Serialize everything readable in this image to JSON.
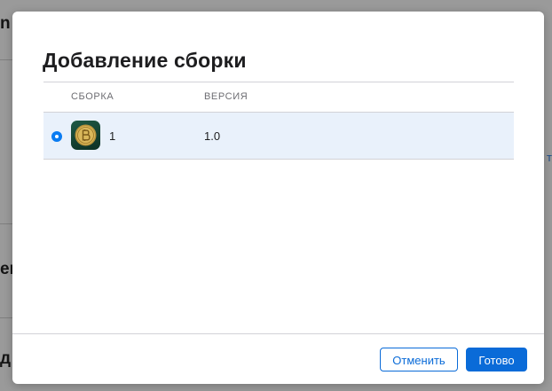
{
  "background": {
    "fragments": [
      "n",
      "er",
      "д"
    ],
    "link_fragment": "т"
  },
  "modal": {
    "title": "Добавление сборки",
    "table": {
      "columns": [
        "СБОРКА",
        "ВЕРСИЯ"
      ],
      "rows": [
        {
          "selected": true,
          "icon": "bitcoin-app-icon",
          "build": "1",
          "version": "1.0"
        }
      ]
    },
    "buttons": {
      "cancel_label": "Отменить",
      "done_label": "Готово"
    }
  },
  "colors": {
    "accent": "#0a6bd8",
    "selected_row": "#e9f1fb",
    "radio": "#0a7cf2"
  }
}
